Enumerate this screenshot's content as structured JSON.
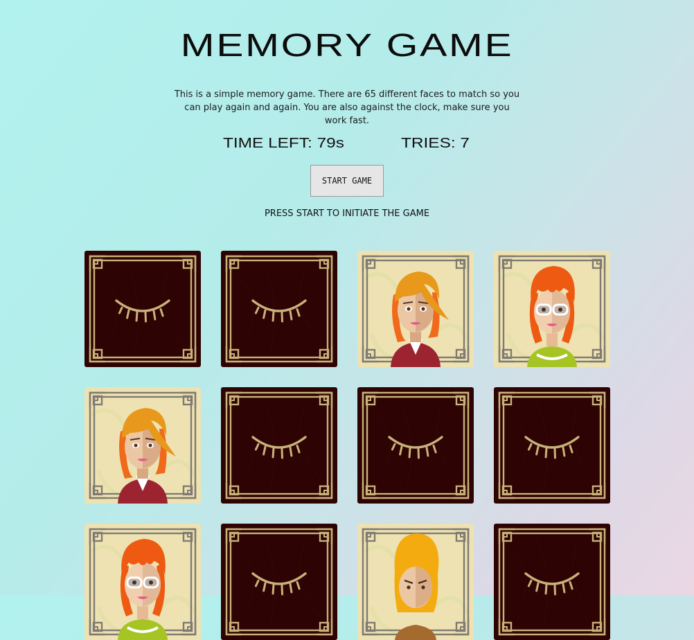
{
  "title": "MEMORY GAME",
  "intro": "This is a simple memory game. There are 65 different faces to match so you can play again and again. You are also against the clock, make sure you work fast.",
  "stats": {
    "time_label": "TIME LEFT: 79s",
    "tries_label": "TRIES: 7"
  },
  "start_button": "START GAME",
  "status_message": "PRESS START TO INITIATE THE GAME",
  "colors": {
    "card_back": "#2e0303",
    "card_face_bg": "#eee2b2",
    "card_border": "#c9b27a",
    "face_frame": "#7f7b72"
  },
  "cards": [
    {
      "state": "hidden",
      "icon": "closed-eye-icon"
    },
    {
      "state": "hidden",
      "icon": "closed-eye-icon"
    },
    {
      "state": "revealed",
      "face": "orange-hair-red-sweater"
    },
    {
      "state": "revealed",
      "face": "red-hair-glasses-green-shirt"
    },
    {
      "state": "revealed",
      "face": "orange-hair-red-sweater"
    },
    {
      "state": "hidden",
      "icon": "closed-eye-icon"
    },
    {
      "state": "hidden",
      "icon": "closed-eye-icon"
    },
    {
      "state": "hidden",
      "icon": "closed-eye-icon"
    },
    {
      "state": "revealed",
      "face": "red-hair-glasses-green-shirt"
    },
    {
      "state": "hidden",
      "icon": "closed-eye-icon"
    },
    {
      "state": "revealed",
      "face": "yellow-hair-frown"
    },
    {
      "state": "hidden",
      "icon": "closed-eye-icon"
    }
  ]
}
